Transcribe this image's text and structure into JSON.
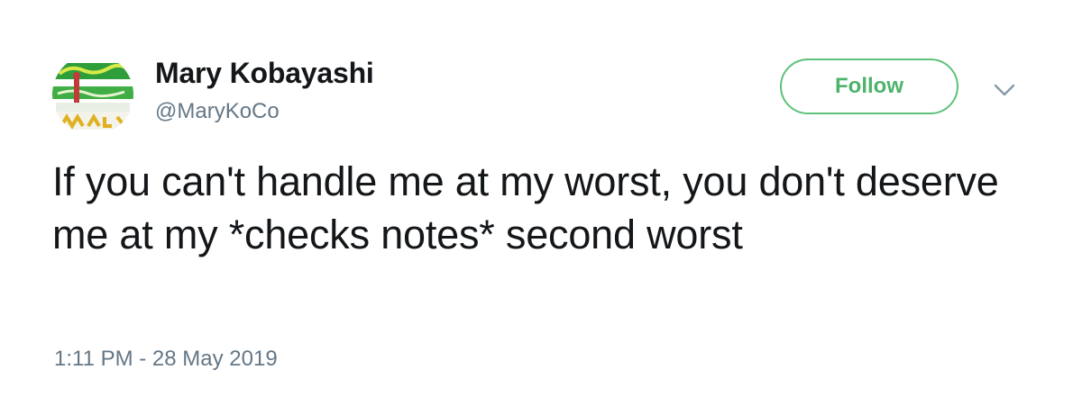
{
  "author": {
    "display_name": "Mary Kobayashi",
    "handle": "@MaryKoCo",
    "avatar_icon": "profile-picture-icon"
  },
  "actions": {
    "follow_label": "Follow",
    "more_icon": "chevron-down-icon"
  },
  "tweet": {
    "text": "If you can't handle me at my worst, you don't deserve me at my *checks notes* second worst",
    "timestamp": "1:11 PM - 28 May 2019"
  },
  "colors": {
    "follow_accent": "#4db36a",
    "secondary_text": "#657786",
    "primary_text": "#14171a"
  }
}
